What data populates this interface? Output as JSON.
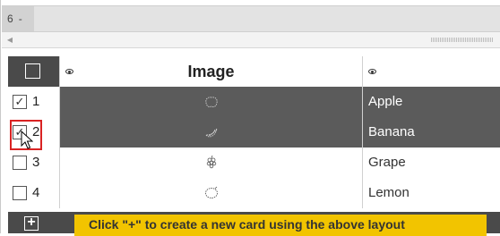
{
  "pager": {
    "current_page": "6",
    "separator": "-"
  },
  "table": {
    "columns": [
      {
        "key": "image",
        "label": "Image"
      },
      {
        "key": "name",
        "label": ""
      }
    ],
    "rows": [
      {
        "num": "1",
        "checked": true,
        "name": "Apple",
        "icon": "apple-icon",
        "selected": true
      },
      {
        "num": "2",
        "checked": true,
        "name": "Banana",
        "icon": "banana-icon",
        "selected": true
      },
      {
        "num": "3",
        "checked": false,
        "name": "Grape",
        "icon": "grape-icon",
        "selected": false
      },
      {
        "num": "4",
        "checked": false,
        "name": "Lemon",
        "icon": "lemon-icon",
        "selected": false
      }
    ]
  },
  "footer": {
    "add_label": "+",
    "hint": "Click \"+\" to create a new card using the above layout"
  },
  "colors": {
    "selected_row": "#5b5b5b",
    "header_dark": "#4a4a4a",
    "hint_bg": "#f2c400",
    "focus_border": "#d92323"
  }
}
